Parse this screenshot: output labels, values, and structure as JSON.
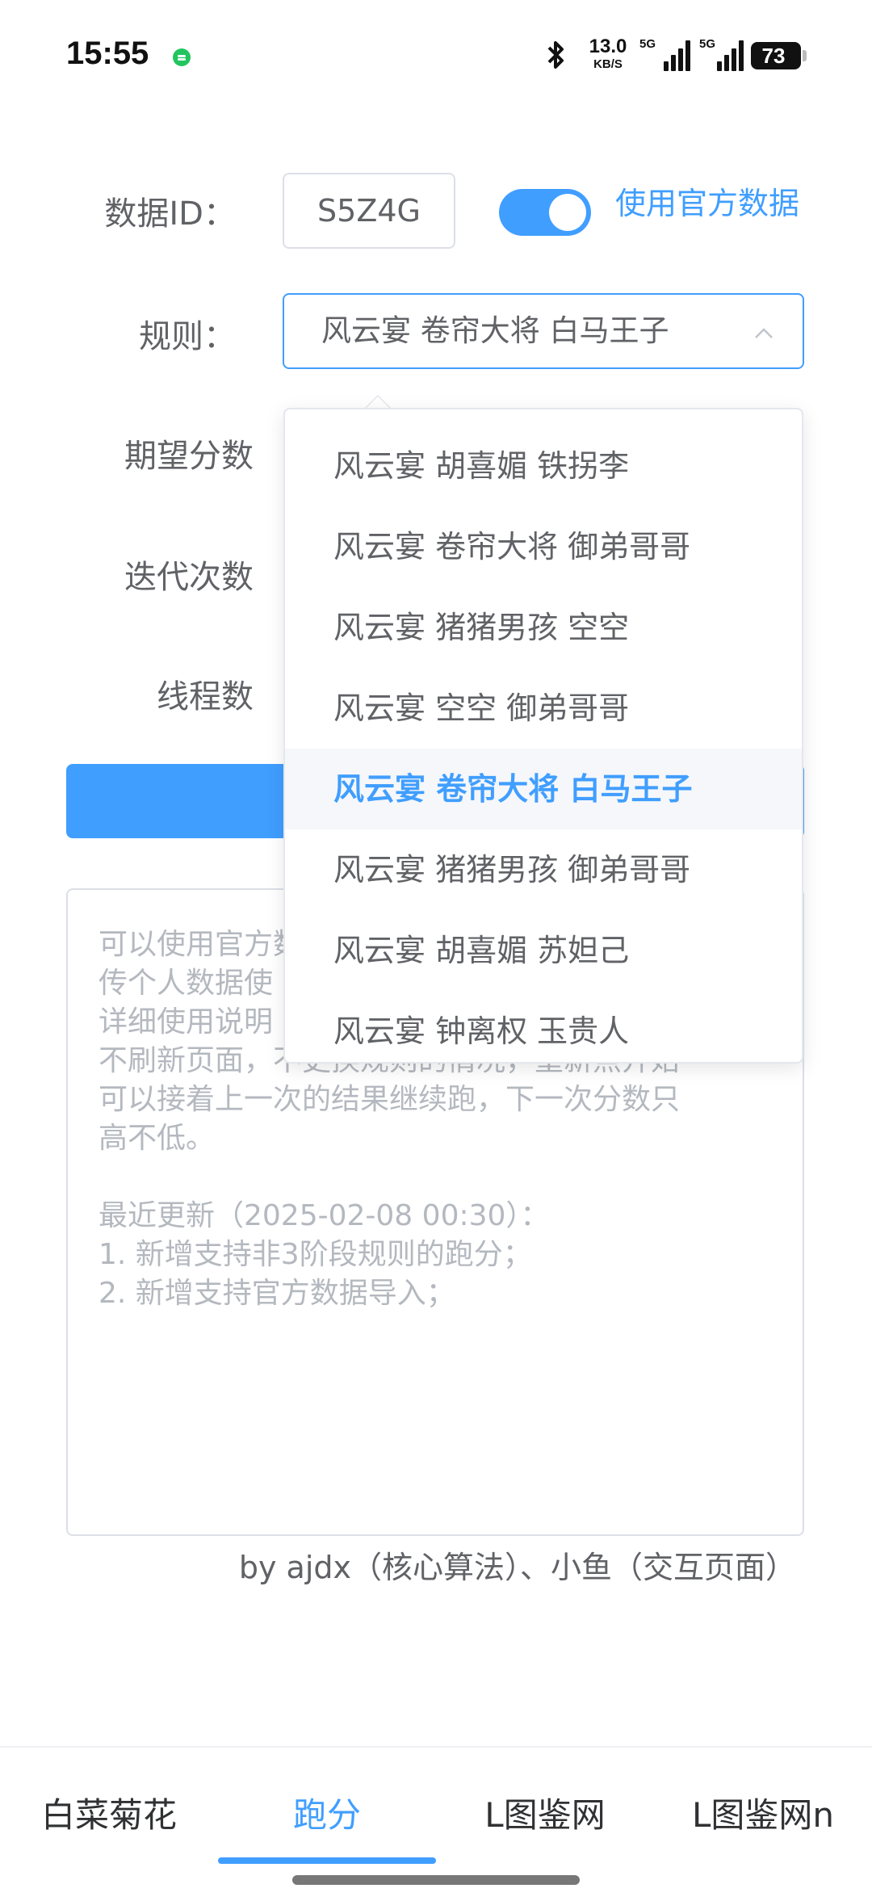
{
  "status_bar": {
    "time": "15:55",
    "net_speed_value": "13.0",
    "net_speed_unit": "KB/S",
    "sim1_label": "5G",
    "sim2_label": "5G",
    "battery": "73"
  },
  "form": {
    "data_id_label": "数据ID：",
    "data_id_value": "S5Z4G",
    "toggle_label": "使用官方数据",
    "toggle_on": true,
    "rule_label": "规则：",
    "rule_value": "风云宴 卷帘大将 白马王子",
    "expected_score_label": "期望分数",
    "iterations_label": "迭代次数",
    "threads_label": "线程数"
  },
  "dropdown": {
    "options": [
      "风云宴 胡喜媚 铁拐李",
      "风云宴 卷帘大将 御弟哥哥",
      "风云宴 猪猪男孩 空空",
      "风云宴 空空 御弟哥哥",
      "风云宴 卷帘大将 白马王子",
      "风云宴 猪猪男孩 御弟哥哥",
      "风云宴 胡喜媚 苏妲己",
      "风云宴 钟离权 玉贵人"
    ],
    "selected_index": 4
  },
  "notes": {
    "line1": "可以使用官方数据或上",
    "line2": "传个人数据使",
    "line3": "详细使用说明",
    "line4": "不刷新页面，不更换规则的情况，重新点开始",
    "line5": "可以接着上一次的结果继续跑，下一次分数只",
    "line6": "高不低。",
    "update_title": "最近更新（2025-02-08 00:30）：",
    "update_1": "1. 新增支持非3阶段规则的跑分；",
    "update_2": "2. 新增支持官方数据导入；"
  },
  "byline": "by ajdx（核心算法）、小鱼（交互页面）",
  "bottom_nav": {
    "tabs": [
      "白菜菊花",
      "跑分",
      "L图鉴网",
      "L图鉴网n"
    ],
    "active_index": 1
  },
  "colors": {
    "accent": "#409eff",
    "text": "#606266",
    "placeholder": "#b4b8bf",
    "border": "#dcdfe6"
  }
}
